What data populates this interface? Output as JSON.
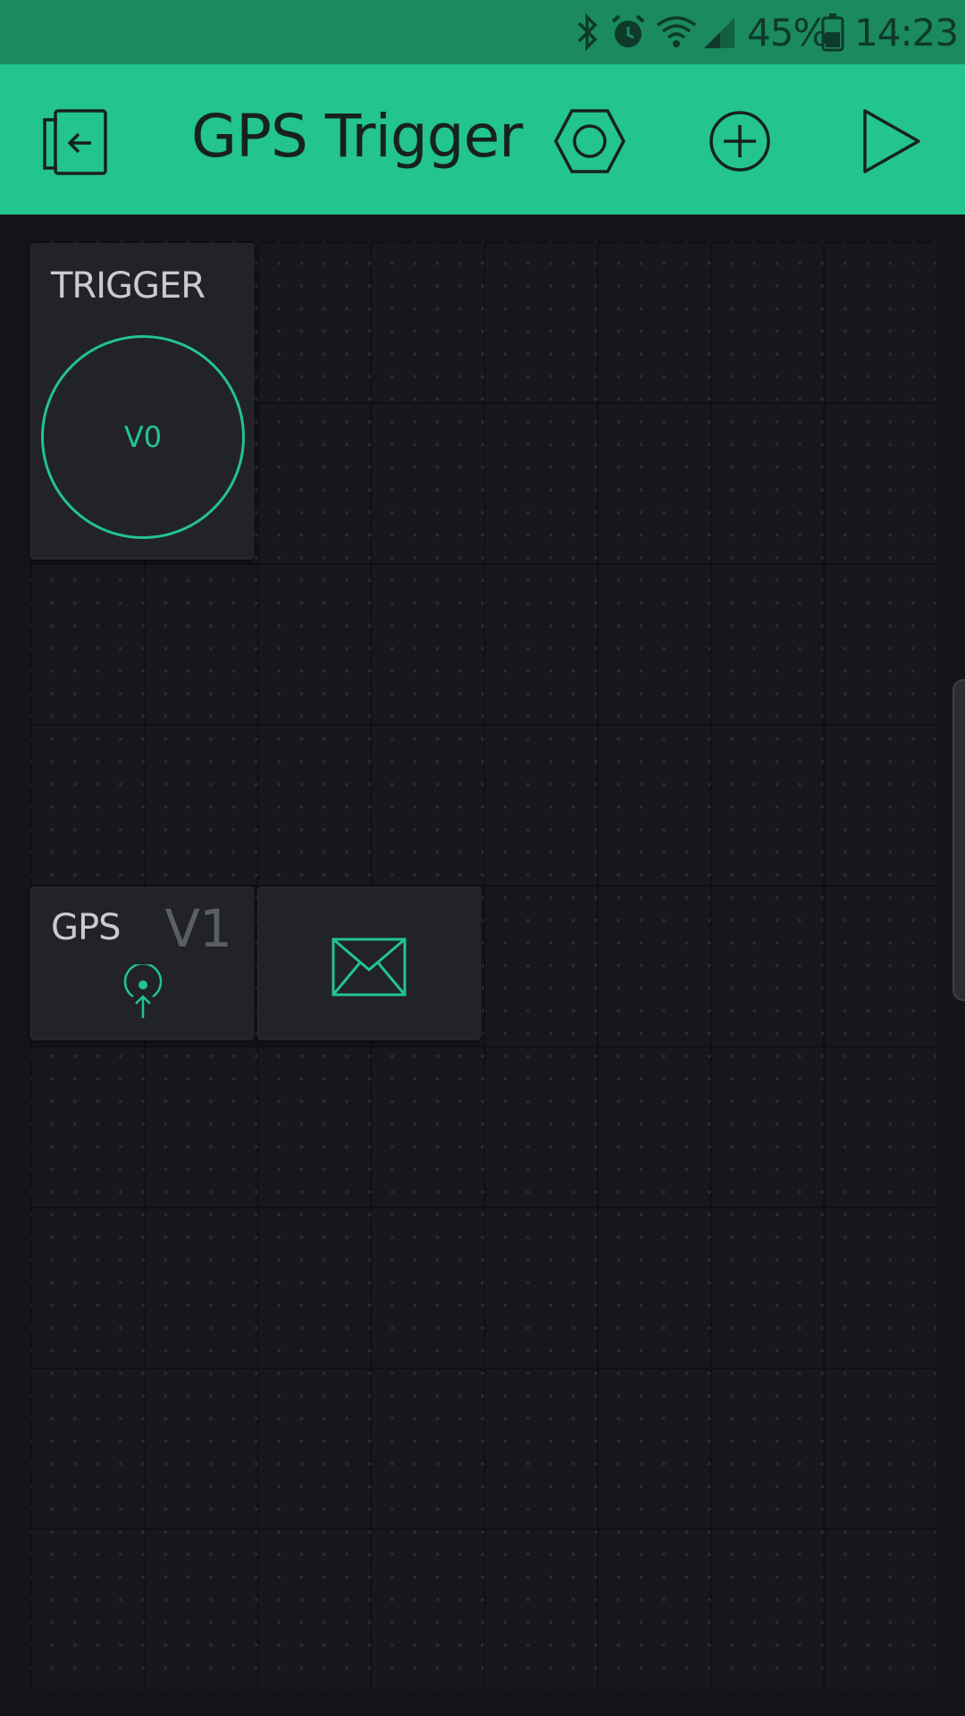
{
  "status_bar": {
    "battery_percent": "45%",
    "time": "14:23",
    "icons": [
      "bluetooth-icon",
      "alarm-icon",
      "wifi-icon",
      "signal-icon",
      "battery-icon"
    ]
  },
  "app_bar": {
    "title": "GPS Trigger",
    "buttons": [
      "exit-icon",
      "settings-hexagon-icon",
      "add-icon",
      "play-icon"
    ]
  },
  "widgets": {
    "trigger": {
      "title": "TRIGGER",
      "pin": "V0"
    },
    "gps": {
      "title": "GPS",
      "pin": "V1"
    },
    "email": {
      "icon": "envelope-icon"
    }
  },
  "colors": {
    "accent": "#23c48e",
    "status_bar": "#1c8a60",
    "background": "#14151a",
    "widget": "#212328"
  }
}
